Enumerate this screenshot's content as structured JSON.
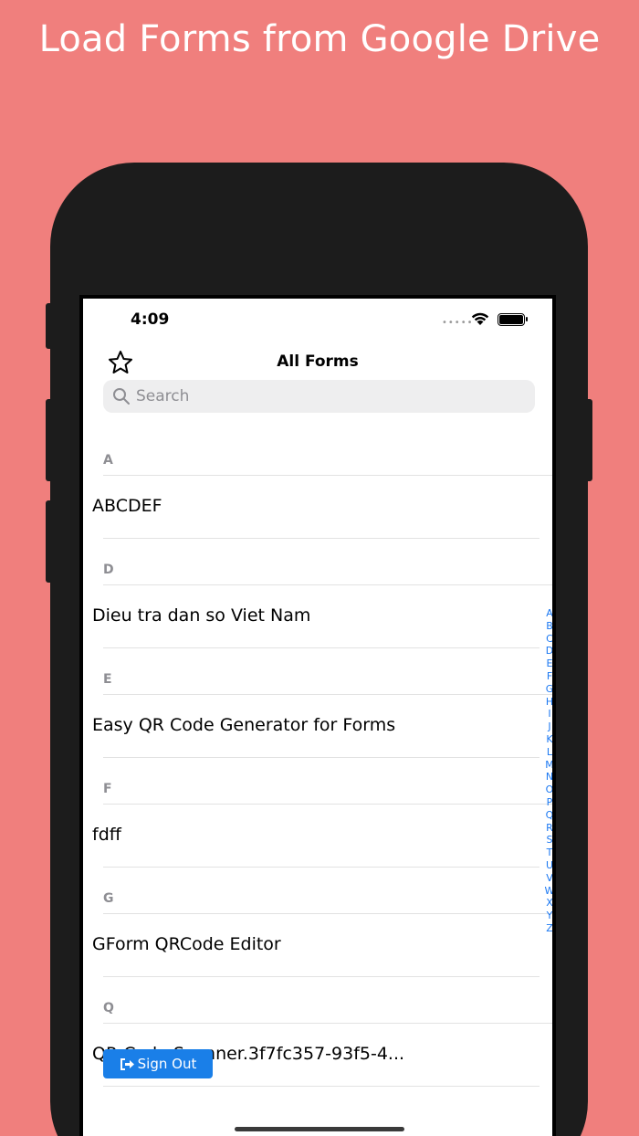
{
  "headline": "Load Forms from Google Drive",
  "status_bar": {
    "time": "4:09",
    "dots": "•••••"
  },
  "nav": {
    "title": "All Forms"
  },
  "search": {
    "placeholder": "Search"
  },
  "sections": [
    {
      "letter": "A",
      "item": "ABCDEF"
    },
    {
      "letter": "D",
      "item": "Dieu tra dan so Viet Nam"
    },
    {
      "letter": "E",
      "item": "Easy QR Code Generator for Forms"
    },
    {
      "letter": "F",
      "item": "fdff"
    },
    {
      "letter": "G",
      "item": "GForm QRCode Editor"
    },
    {
      "letter": "Q",
      "item": "QR Code Scanner.3f7fc357-93f5-4..."
    }
  ],
  "index_letters": [
    "A",
    "B",
    "C",
    "D",
    "E",
    "F",
    "G",
    "H",
    "I",
    "J",
    "K",
    "L",
    "M",
    "N",
    "O",
    "P",
    "Q",
    "R",
    "S",
    "T",
    "U",
    "V",
    "W",
    "X",
    "Y",
    "Z"
  ],
  "signout": {
    "label": "Sign Out"
  },
  "colors": {
    "background": "#f07f7d",
    "accent": "#1a7fe8",
    "index": "#1b78f2"
  }
}
